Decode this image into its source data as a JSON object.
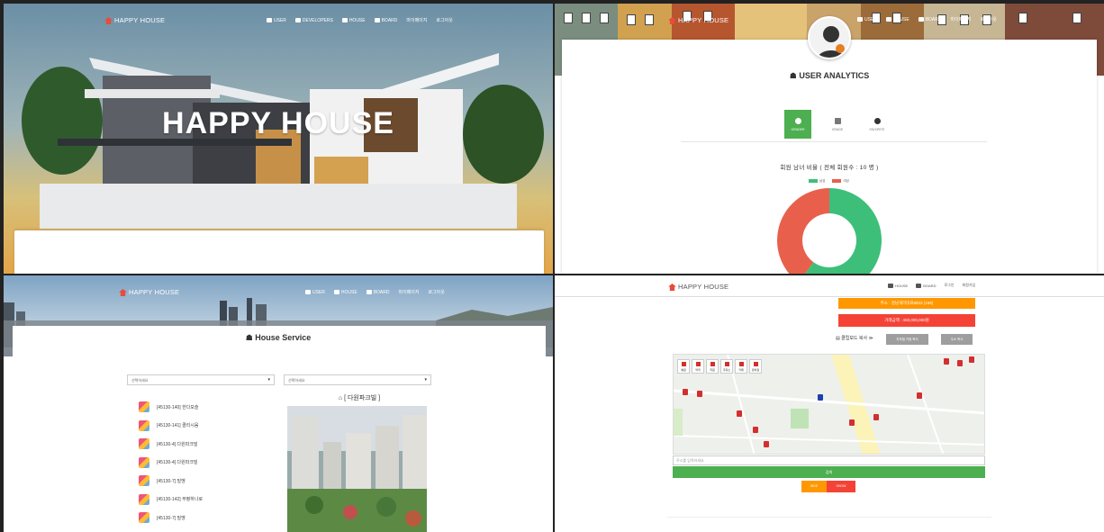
{
  "brand": "HAPPY HOUSE",
  "panel1": {
    "menu": [
      "USER",
      "DEVELOPERS",
      "HOUSE",
      "BOARD",
      "마이페이지",
      "로그아웃"
    ],
    "hero_title": "HAPPY HOUSE"
  },
  "panel2": {
    "menu": [
      "USER",
      "HOUSE",
      "BOARD",
      "마이페이지",
      "로그아웃"
    ],
    "title": "USER ANALYTICS",
    "tabs": [
      "GENDER",
      "GRADE",
      "FAVORITE"
    ],
    "active_tab": "GENDER",
    "ratio_text": "회원 남녀 비율 ( 전체 회원수 : 10 명 )",
    "legend": [
      {
        "label": "남성",
        "color": "#3dbf7a"
      },
      {
        "label": "여성",
        "color": "#e8604c"
      }
    ],
    "chart_data": {
      "type": "pie",
      "labels": [
        "남성",
        "여성"
      ],
      "values": [
        6,
        4
      ]
    }
  },
  "panel3": {
    "menu": [
      "USER",
      "HOUSE",
      "BOARD",
      "마이페이지",
      "로그아웃"
    ],
    "title": "House Service",
    "select1_placeholder": "선택하세요",
    "select2_placeholder": "선택하세요",
    "apt_title": "[ 다원파크빌 ]",
    "houses": [
      "[45130-140] 한다모슬",
      "[45130-141] 클리시움",
      "[45130-4] 다원파크빌",
      "[45130-4] 다원파크빌",
      "[45130-7] 빌맹",
      "[45130-142] 부평하나로",
      "[45130-7] 빌맹"
    ]
  },
  "panel4": {
    "menu": [
      "HOUSE",
      "BOARD",
      "로그인",
      "회원가입"
    ],
    "address": "주소 : 경남개라대료8823 (158)",
    "price": "거래금액 : 450,000,000원",
    "clipboard": "클립보드 복사 ≫",
    "btn_a": "지하철 거점 복사",
    "btn_b": "주소 복사",
    "categories": [
      "병원",
      "약국",
      "학원",
      "주유소",
      "카페",
      "편의점"
    ],
    "addr_placeholder": "주소를 입력하세요.",
    "search_label": "검색",
    "hide_label": "HIDE",
    "show_label": "SHOW"
  }
}
